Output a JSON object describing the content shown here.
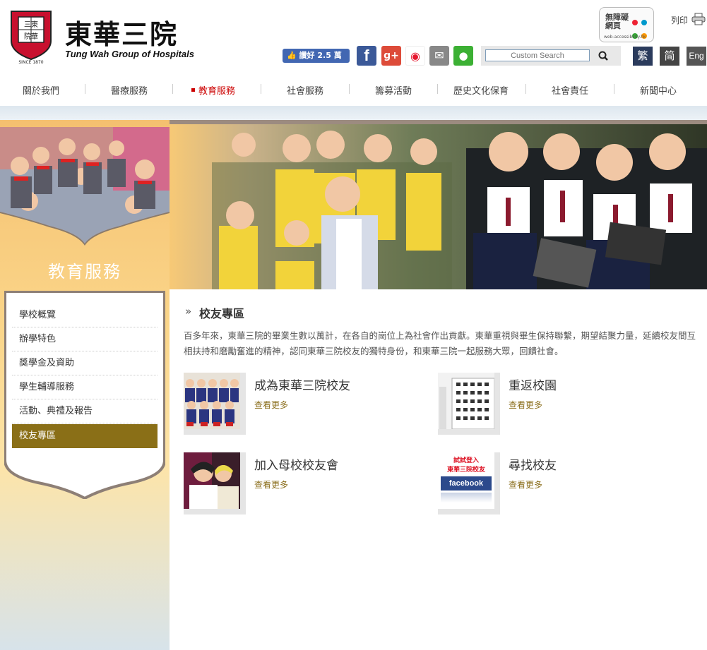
{
  "header": {
    "logo_cn": "東華三院",
    "logo_en": "Tung Wah Group of Hospitals",
    "logo_seal_lines": [
      "三東",
      "院華",
      "SINCE 1870"
    ],
    "accessibility_badge": {
      "text": "無障礙網頁",
      "url": "web-accessibility.hk"
    },
    "print_label": "列印",
    "fb_like_label": "讚好 2.5 萬",
    "search_placeholder": "Custom Search",
    "languages": [
      "繁",
      "简",
      "Eng"
    ]
  },
  "nav": {
    "items": [
      "關於我們",
      "醫療服務",
      "教育服務",
      "社會服務",
      "籌募活動",
      "歷史文化保育",
      "社會責任",
      "新聞中心"
    ],
    "active_index": 2
  },
  "left": {
    "section_title": "教育服務",
    "sidebar_items": [
      "學校概覽",
      "辦學特色",
      "獎學金及資助",
      "學生輔導服務",
      "活動、典禮及報告",
      "校友專區"
    ],
    "active_index": 5
  },
  "main": {
    "title": "校友專區",
    "intro": "百多年來，東華三院的畢業生數以萬計，在各自的崗位上為社會作出貢獻。東華重視與畢生保持聯繫，期望結聚力量，延續校友間互相扶持和磨勵奮進的精神，認同東華三院校友的獨特身份，和東華三院一起服務大眾，回饋社會。",
    "cards": [
      {
        "title": "成為東華三院校友",
        "more": "查看更多"
      },
      {
        "title": "重返校園",
        "more": "查看更多"
      },
      {
        "title": "加入母校校友會",
        "more": "查看更多"
      },
      {
        "title": "尋找校友",
        "more": "查看更多",
        "thumb_text": [
          "試試登入",
          "東華三院校友",
          "facebook"
        ]
      }
    ]
  },
  "colors": {
    "accent_red": "#cc0000",
    "sidebar_active": "#8a6f17",
    "link_gold": "#8a6d1a"
  }
}
